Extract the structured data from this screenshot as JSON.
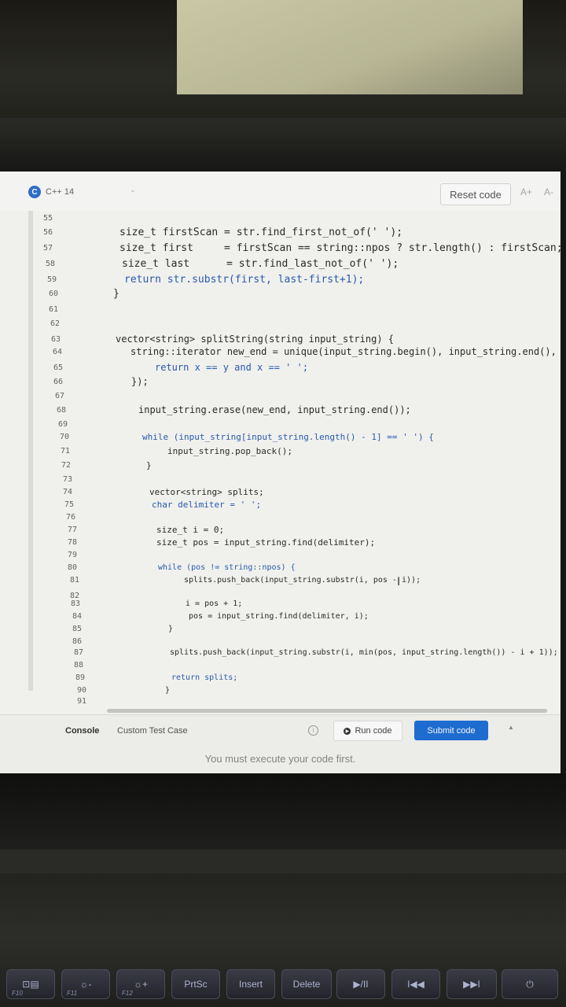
{
  "header": {
    "language": "C++ 14",
    "reset_label": "Reset code",
    "font_up": "A+",
    "font_down": "A-"
  },
  "code_lines": [
    {
      "n": "55",
      "text": ""
    },
    {
      "n": "56",
      "text": "size_t firstScan = str.find_first_not_of(' ');"
    },
    {
      "n": "57",
      "text": "size_t first     = firstScan == string::npos ? str.length() : firstScan;"
    },
    {
      "n": "58",
      "text": "size_t last      = str.find_last_not_of(' ');"
    },
    {
      "n": "59",
      "text": "return str.substr(first, last-first+1);"
    },
    {
      "n": "60",
      "text": "}"
    },
    {
      "n": "61",
      "text": ""
    },
    {
      "n": "62",
      "text": ""
    },
    {
      "n": "63",
      "text": "vector<string> splitString(string input_string) {"
    },
    {
      "n": "64",
      "text": "string::iterator new_end = unique(input_string.begin(), input_string.end(), [] (c"
    },
    {
      "n": "65",
      "text": "return x == y and x == ' ';"
    },
    {
      "n": "66",
      "text": "});"
    },
    {
      "n": "67",
      "text": ""
    },
    {
      "n": "68",
      "text": "input_string.erase(new_end, input_string.end());"
    },
    {
      "n": "69",
      "text": ""
    },
    {
      "n": "70",
      "text": "while (input_string[input_string.length() - 1] == ' ') {"
    },
    {
      "n": "71",
      "text": "input_string.pop_back();"
    },
    {
      "n": "72",
      "text": "}"
    },
    {
      "n": "73",
      "text": ""
    },
    {
      "n": "74",
      "text": "vector<string> splits;"
    },
    {
      "n": "75",
      "text": "char delimiter = ' ';"
    },
    {
      "n": "76",
      "text": ""
    },
    {
      "n": "77",
      "text": "size_t i = 0;"
    },
    {
      "n": "78",
      "text": "size_t pos = input_string.find(delimiter);"
    },
    {
      "n": "79",
      "text": ""
    },
    {
      "n": "80",
      "text": "while (pos != string::npos) {"
    },
    {
      "n": "81",
      "text": "splits.push_back(input_string.substr(i, pos - i));"
    },
    {
      "n": "82",
      "text": ""
    },
    {
      "n": "83",
      "text": "i = pos + 1;"
    },
    {
      "n": "84",
      "text": "pos = input_string.find(delimiter, i);"
    },
    {
      "n": "85",
      "text": "}"
    },
    {
      "n": "86",
      "text": ""
    },
    {
      "n": "87",
      "text": "splits.push_back(input_string.substr(i, min(pos, input_string.length()) - i + 1));"
    },
    {
      "n": "88",
      "text": ""
    },
    {
      "n": "89",
      "text": "return splits;"
    },
    {
      "n": "90",
      "text": "}"
    },
    {
      "n": "91",
      "text": ""
    }
  ],
  "bottom": {
    "console_tab": "Console",
    "custom_tab": "Custom Test Case",
    "run_label": "Run code",
    "submit_label": "Submit code",
    "message": "You must execute your code first."
  },
  "keyboard": [
    {
      "name": "f10",
      "label": "⊡▤",
      "sub": "F10"
    },
    {
      "name": "f11",
      "label": "☼-",
      "sub": "F11"
    },
    {
      "name": "f12",
      "label": "☼+",
      "sub": "F12"
    },
    {
      "name": "prtsc",
      "label": "PrtSc",
      "sub": ""
    },
    {
      "name": "insert",
      "label": "Insert",
      "sub": ""
    },
    {
      "name": "delete",
      "label": "Delete",
      "sub": ""
    },
    {
      "name": "play-pause",
      "label": "▶/II",
      "sub": ""
    },
    {
      "name": "prev-track",
      "label": "I◀◀",
      "sub": ""
    },
    {
      "name": "next-track",
      "label": "▶▶I",
      "sub": ""
    },
    {
      "name": "power",
      "label": "⏻",
      "sub": ""
    }
  ]
}
